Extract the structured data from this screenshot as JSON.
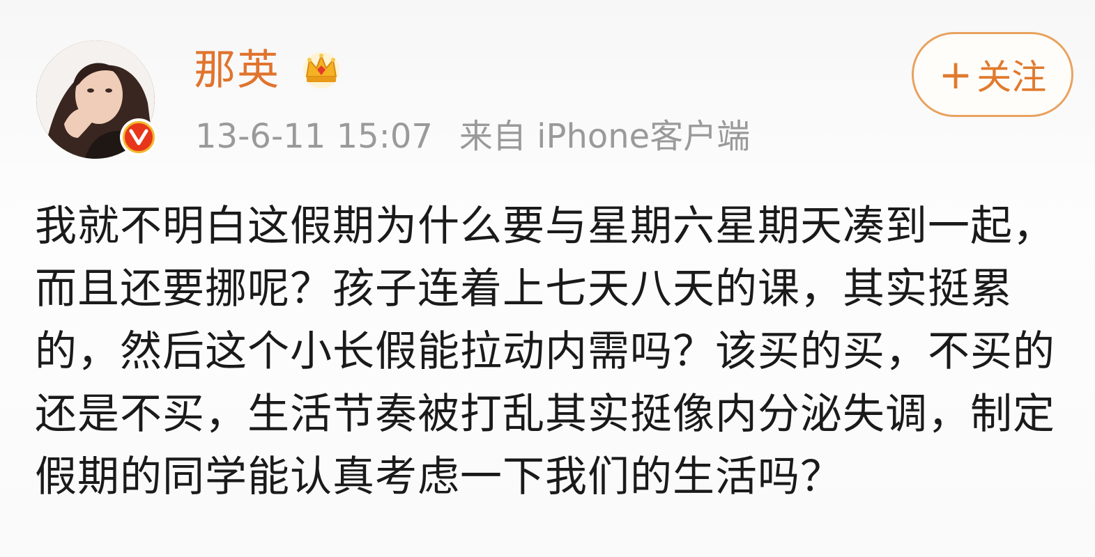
{
  "user": {
    "name": "那英",
    "avatar_icon": "user-avatar",
    "crown_icon": "crown-icon",
    "badge_icon": "verified-v-icon",
    "badge_letter": "V"
  },
  "meta": {
    "timestamp": "13-6-11 15:07",
    "source": "来自 iPhone客户端"
  },
  "follow_button": {
    "plus": "+",
    "label": "关注"
  },
  "post": {
    "text": "我就不明白这假期为什么要与星期六星期天凑到一起，而且还要挪呢？孩子连着上七天八天的课，其实挺累的，然后这个小长假能拉动内需吗？该买的买，不买的还是不买，生活节奏被打乱其实挺像内分泌失调，制定假期的同学能认真考虑一下我们的生活吗？"
  },
  "colors": {
    "name": "#e0742e",
    "meta": "#9a9a9a",
    "follow_border": "#e8a25f",
    "badge_red": "#e8361b",
    "badge_gold": "#f2b72b",
    "text": "#1a1a1a"
  }
}
